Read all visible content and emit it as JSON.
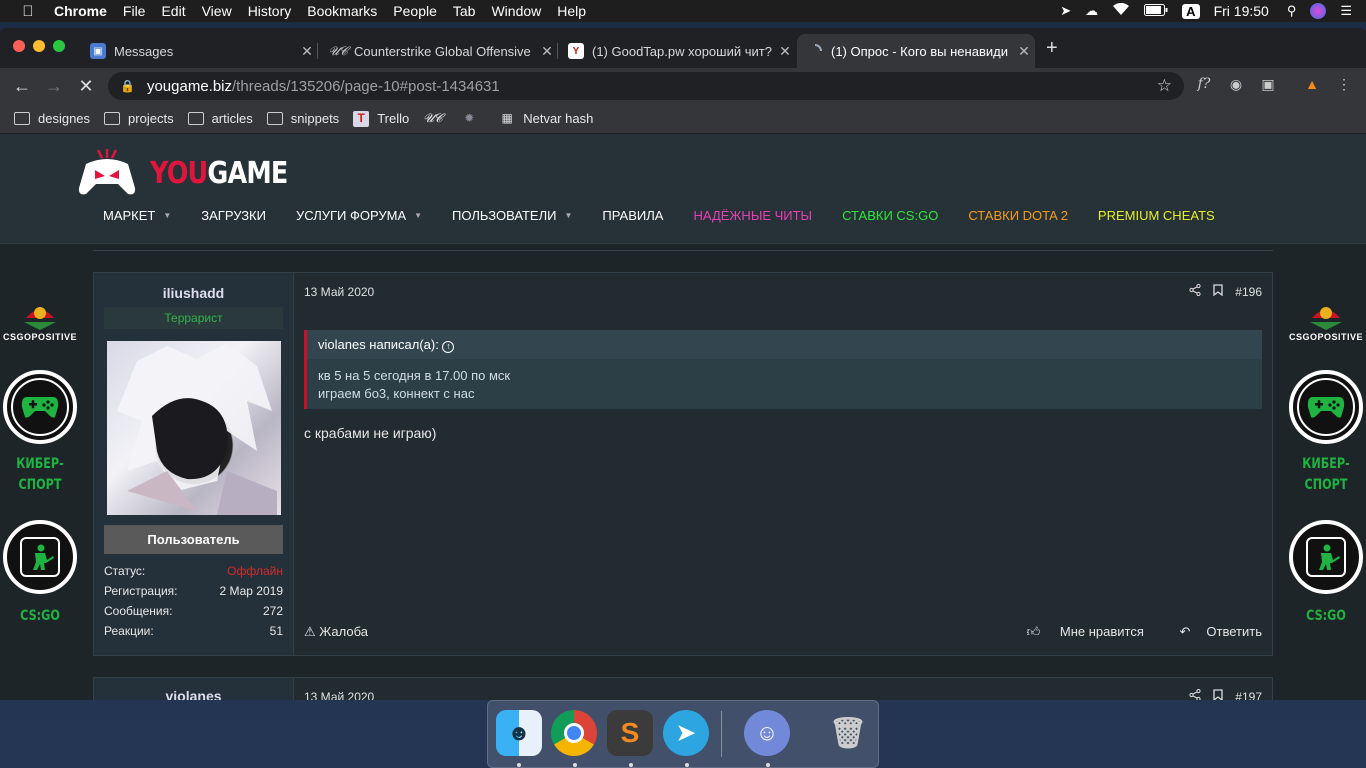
{
  "menubar": {
    "app": "Chrome",
    "items": [
      "File",
      "Edit",
      "View",
      "History",
      "Bookmarks",
      "People",
      "Tab",
      "Window",
      "Help"
    ],
    "clock": "Fri 19:50",
    "input_source": "A"
  },
  "tabs": [
    {
      "title": "Messages",
      "favicon": "messages-icon",
      "color": "#4a7bd0"
    },
    {
      "title": "Counterstrike Global Offensive",
      "favicon": "uc-icon",
      "color": "#555"
    },
    {
      "title": "(1) GoodTap.pw хороший чит?",
      "favicon": "yougame-icon",
      "color": "#c42"
    },
    {
      "title": "(1) Опрос - Кого вы ненавиди",
      "favicon": "loading-icon",
      "color": "#35363a",
      "active": true
    }
  ],
  "address": {
    "host": "yougame.biz",
    "path": "/threads/135206/page-10#post-1434631"
  },
  "bookmarks": [
    {
      "label": "designes",
      "type": "folder"
    },
    {
      "label": "projects",
      "type": "folder"
    },
    {
      "label": "articles",
      "type": "folder"
    },
    {
      "label": "snippets",
      "type": "folder"
    },
    {
      "label": "Trello",
      "type": "site"
    },
    {
      "label": "",
      "type": "uc"
    },
    {
      "label": "",
      "type": "spinner"
    },
    {
      "label": "Netvar hash",
      "type": "site"
    }
  ],
  "site": {
    "logo_you": "YOU",
    "logo_game": "GAME",
    "nav": [
      {
        "label": "МАРКЕТ",
        "color": "#ffffff",
        "caret": true
      },
      {
        "label": "ЗАГРУЗКИ",
        "color": "#ffffff",
        "caret": false
      },
      {
        "label": "УСЛУГИ ФОРУМА",
        "color": "#ffffff",
        "caret": true
      },
      {
        "label": "ПОЛЬЗОВАТЕЛИ",
        "color": "#ffffff",
        "caret": true
      },
      {
        "label": "ПРАВИЛА",
        "color": "#ffffff",
        "caret": false
      },
      {
        "label": "НАДЁЖНЫЕ ЧИТЫ",
        "color": "#e83fb4",
        "caret": false
      },
      {
        "label": "СТАВКИ CS:GO",
        "color": "#2ee63a",
        "caret": false
      },
      {
        "label": "СТАВКИ DOTA 2",
        "color": "#f59d1a",
        "caret": false
      },
      {
        "label": "PREMIUM CHEATS",
        "color": "#e6f020",
        "caret": false
      }
    ]
  },
  "banner": {
    "brand": "CSGOPOSITIVE",
    "label1_line1": "КИБЕР-",
    "label1_line2": "СПОРТ",
    "label2": "CS:GO"
  },
  "post196": {
    "username": "iliushadd",
    "user_title": "Террарист",
    "badge": "Пользователь",
    "stats": [
      {
        "label": "Статус:",
        "value": "Оффлайн"
      },
      {
        "label": "Регистрация:",
        "value": "2 Мар 2019"
      },
      {
        "label": "Сообщения:",
        "value": "272"
      },
      {
        "label": "Реакции:",
        "value": "51"
      }
    ],
    "date": "13 Май 2020",
    "number": "#196",
    "quote_author": "violanes написал(а):",
    "quote_line1": "кв 5 на 5 сегодня в 17.00 по мск",
    "quote_line2": "играем бо3, коннект с нас",
    "text": "с крабами не играю)",
    "report": "Жалоба",
    "like": "Мне нравится",
    "reply": "Ответить"
  },
  "post197": {
    "username": "violanes",
    "date": "13 Май 2020",
    "number": "#197"
  },
  "dock": [
    "Finder",
    "Chrome",
    "Sublime Text",
    "Telegram",
    "Discord",
    "Trash"
  ]
}
